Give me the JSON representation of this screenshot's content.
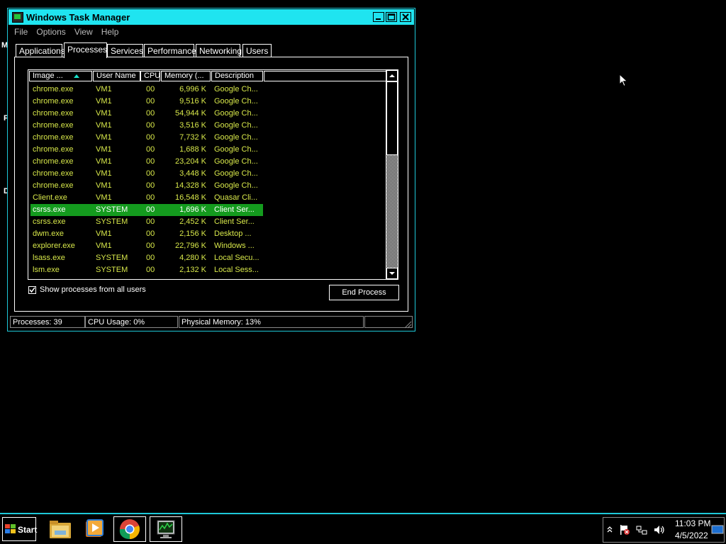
{
  "desktop_fragments": [
    "M",
    "F",
    "D"
  ],
  "window": {
    "title": "Windows Task Manager",
    "menu": [
      "File",
      "Options",
      "View",
      "Help"
    ],
    "tabs": [
      "Applications",
      "Processes",
      "Services",
      "Performance",
      "Networking",
      "Users"
    ],
    "active_tab": "Processes"
  },
  "table": {
    "columns": [
      "Image ...",
      "User Name",
      "CPU",
      "Memory (...",
      "Description"
    ],
    "sorted_column": "Image ...",
    "rows": [
      {
        "name": "chrome.exe",
        "user": "VM1",
        "cpu": "00",
        "mem": "6,996 K",
        "desc": "Google Ch..."
      },
      {
        "name": "chrome.exe",
        "user": "VM1",
        "cpu": "00",
        "mem": "9,516 K",
        "desc": "Google Ch..."
      },
      {
        "name": "chrome.exe",
        "user": "VM1",
        "cpu": "00",
        "mem": "54,944 K",
        "desc": "Google Ch..."
      },
      {
        "name": "chrome.exe",
        "user": "VM1",
        "cpu": "00",
        "mem": "3,516 K",
        "desc": "Google Ch..."
      },
      {
        "name": "chrome.exe",
        "user": "VM1",
        "cpu": "00",
        "mem": "7,732 K",
        "desc": "Google Ch..."
      },
      {
        "name": "chrome.exe",
        "user": "VM1",
        "cpu": "00",
        "mem": "1,688 K",
        "desc": "Google Ch..."
      },
      {
        "name": "chrome.exe",
        "user": "VM1",
        "cpu": "00",
        "mem": "23,204 K",
        "desc": "Google Ch..."
      },
      {
        "name": "chrome.exe",
        "user": "VM1",
        "cpu": "00",
        "mem": "3,448 K",
        "desc": "Google Ch..."
      },
      {
        "name": "chrome.exe",
        "user": "VM1",
        "cpu": "00",
        "mem": "14,328 K",
        "desc": "Google Ch..."
      },
      {
        "name": "Client.exe",
        "user": "VM1",
        "cpu": "00",
        "mem": "16,548 K",
        "desc": "Quasar Cli..."
      },
      {
        "name": "csrss.exe",
        "user": "SYSTEM",
        "cpu": "00",
        "mem": "1,696 K",
        "desc": "Client Ser...",
        "selected": true
      },
      {
        "name": "csrss.exe",
        "user": "SYSTEM",
        "cpu": "00",
        "mem": "2,452 K",
        "desc": "Client Ser..."
      },
      {
        "name": "dwm.exe",
        "user": "VM1",
        "cpu": "00",
        "mem": "2,156 K",
        "desc": "Desktop ..."
      },
      {
        "name": "explorer.exe",
        "user": "VM1",
        "cpu": "00",
        "mem": "22,796 K",
        "desc": "Windows ..."
      },
      {
        "name": "lsass.exe",
        "user": "SYSTEM",
        "cpu": "00",
        "mem": "4,280 K",
        "desc": "Local Secu..."
      },
      {
        "name": "lsm.exe",
        "user": "SYSTEM",
        "cpu": "00",
        "mem": "2,132 K",
        "desc": "Local Sess..."
      }
    ]
  },
  "show_all_label": "Show processes from all users",
  "show_all_checked": true,
  "end_process_label": "End Process",
  "status": {
    "processes": "Processes: 39",
    "cpu": "CPU Usage: 0%",
    "memory": "Physical Memory: 13%"
  },
  "taskbar": {
    "start_label": "Start",
    "apps": [
      "file-explorer-icon",
      "media-player-icon",
      "chrome-icon",
      "task-manager-icon"
    ],
    "time": "11:03 PM",
    "date": "4/5/2022"
  },
  "colors": {
    "accent": "#1fe4f0",
    "row_text": "#d8e84a",
    "selected_row": "#149b1e"
  }
}
